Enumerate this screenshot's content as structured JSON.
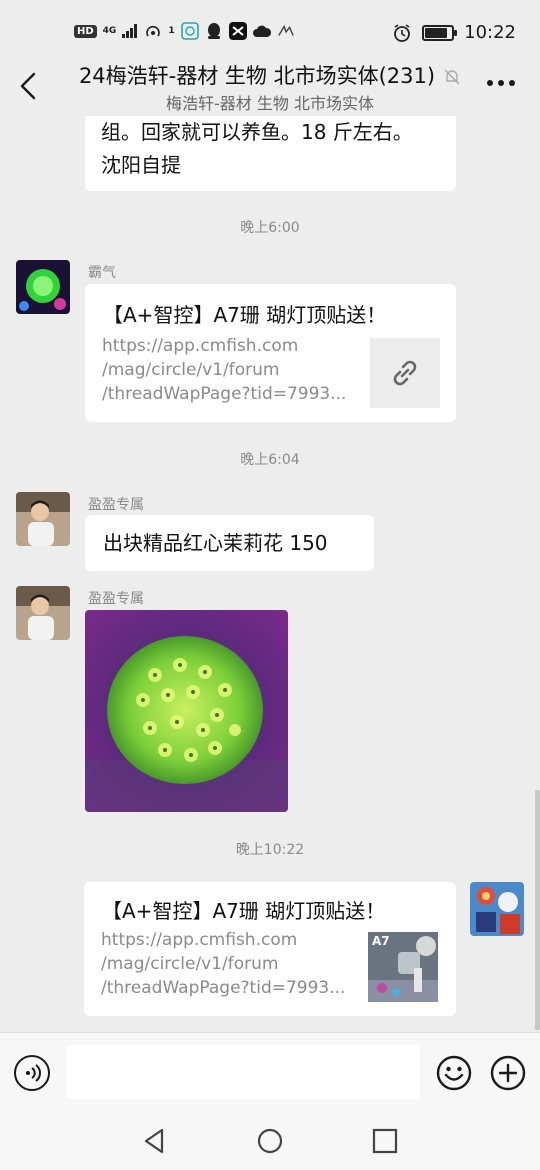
{
  "status_bar": {
    "hd": "HD",
    "network": "4G",
    "hotspot_count": "1",
    "time": "10:22",
    "battery_level": 0.85
  },
  "header": {
    "title": "24梅浩轩-器材 生物 北市场实体(231)",
    "subtitle": "梅浩轩-器材 生物 北市场实体"
  },
  "messages": {
    "m0": {
      "text_line1": "组。回家就可以养鱼。18 斤左右。",
      "text_line2": "沈阳自提"
    },
    "t1": "晚上6:00",
    "m1": {
      "sender": "霸气",
      "link_title": "【A+智控】A7珊 瑚灯顶贴送！",
      "url_line1": "https://app.cmfish.com",
      "url_line2": "/mag/circle/v1/forum",
      "url_line3": "/threadWapPage?tid=7993..."
    },
    "t2": "晚上6:04",
    "m2": {
      "sender": "盈盈专属",
      "text": "出块精品红心茉莉花  150"
    },
    "m3": {
      "sender": "盈盈专属"
    },
    "t3": "晚上10:22",
    "m4": {
      "link_title": "【A+智控】A7珊 瑚灯顶贴送！",
      "url_line1": "https://app.cmfish.com",
      "url_line2": "/mag/circle/v1/forum",
      "url_line3": "/threadWapPage?tid=7993...",
      "thumb_label": "A7"
    }
  },
  "input": {
    "placeholder": ""
  },
  "icons": {
    "back": "chevron-left-icon",
    "mute": "bell-off-icon",
    "more": "more-dots-icon",
    "link": "link-icon",
    "voice": "voice-icon",
    "emoji": "emoji-icon",
    "plus": "plus-icon",
    "nav_back": "triangle-back-icon",
    "nav_home": "circle-home-icon",
    "nav_recent": "square-recent-icon"
  },
  "colors": {
    "background": "#ededed",
    "bubble": "#ffffff",
    "muted_text": "#8a8a8a"
  }
}
